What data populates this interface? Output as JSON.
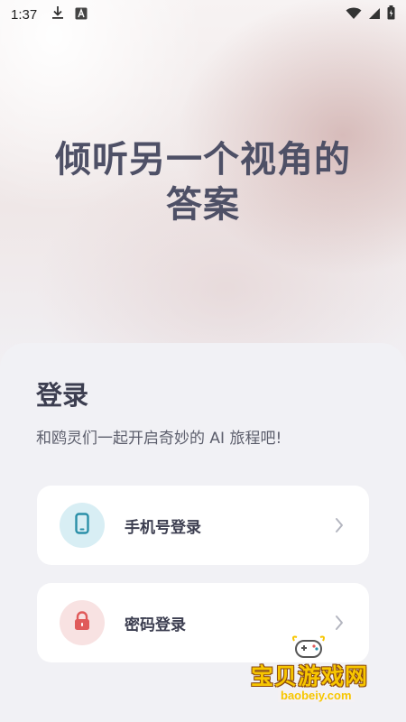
{
  "status_bar": {
    "time": "1:37",
    "left_icons": [
      "download-icon",
      "font-a-icon"
    ],
    "right_icons": [
      "wifi-icon",
      "signal-icon",
      "battery-icon"
    ]
  },
  "hero": {
    "line1": "倾听另一个视角的",
    "line2": "答案"
  },
  "login": {
    "title": "登录",
    "subtitle": "和鸥灵们一起开启奇妙的 AI 旅程吧!",
    "options": [
      {
        "label": "手机号登录",
        "icon": "phone-icon",
        "icon_color": "#2a8fa8",
        "icon_bg": "#d8eef4"
      },
      {
        "label": "密码登录",
        "icon": "lock-icon",
        "icon_color": "#e05a5a",
        "icon_bg": "#f8e2e2"
      }
    ]
  },
  "watermark": {
    "title": "宝贝游戏网",
    "url": "baobeiy.com"
  },
  "colors": {
    "headline": "#4e5066",
    "title": "#3c3e50",
    "sheet_bg": "#f1f1f5",
    "card_bg": "#ffffff"
  }
}
